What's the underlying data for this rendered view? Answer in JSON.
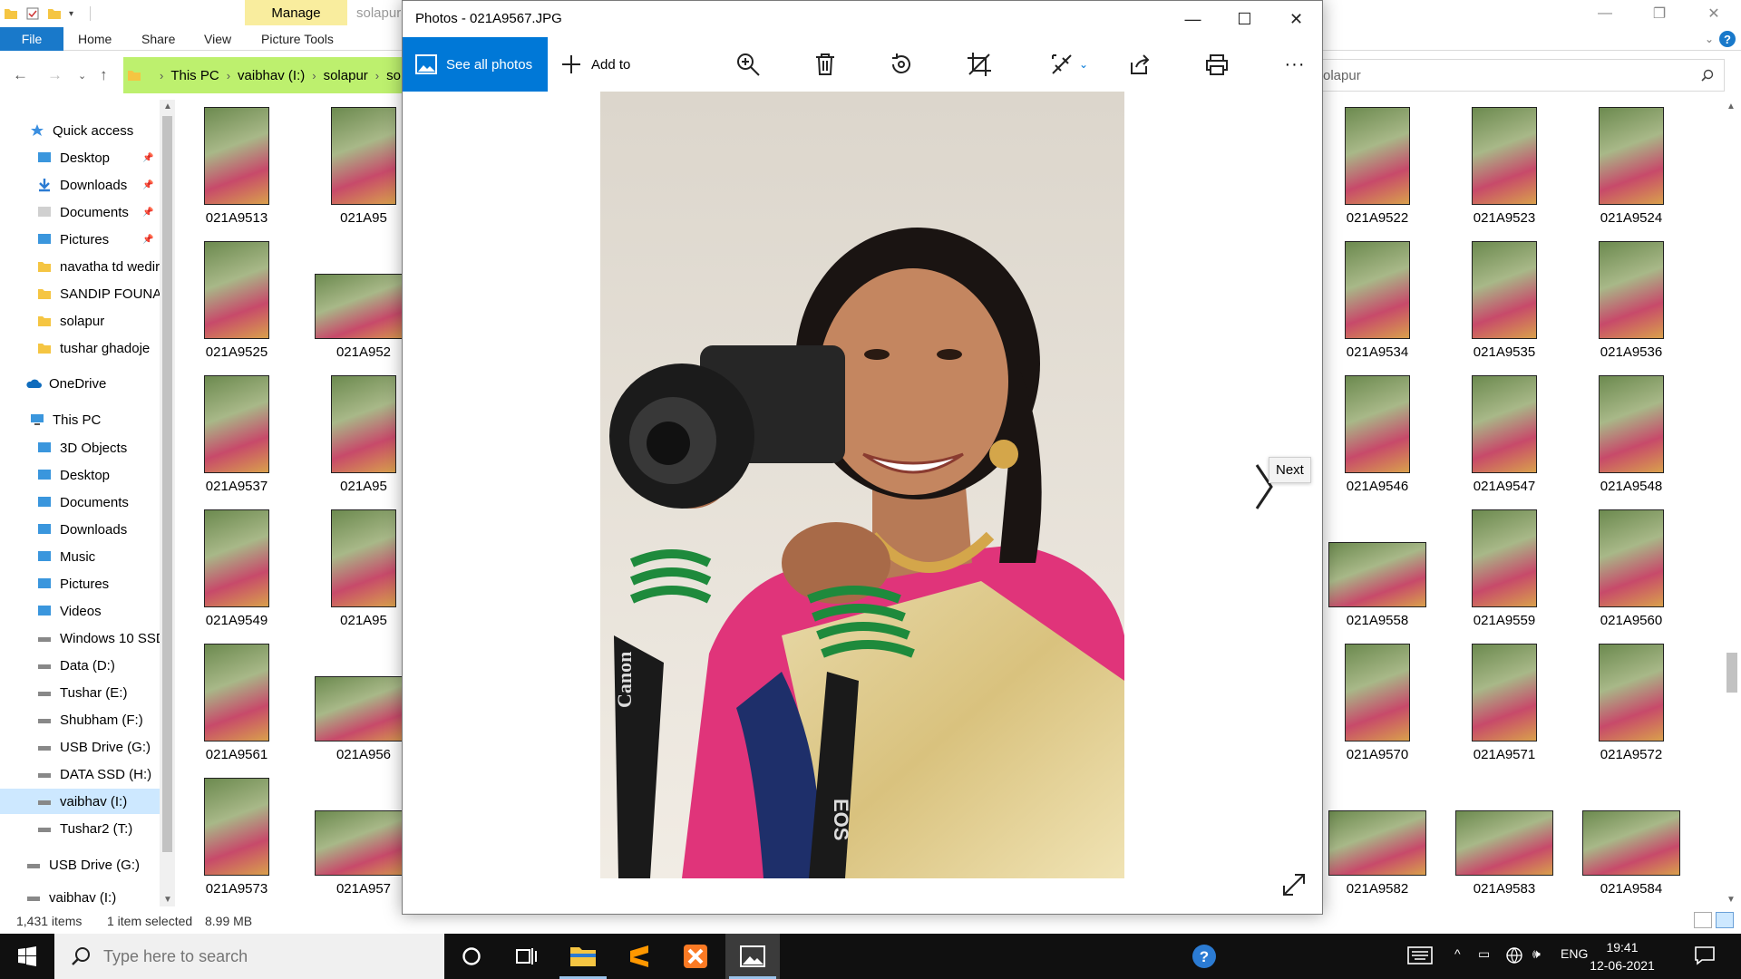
{
  "explorer": {
    "ribbon": {
      "manage_tab": "Manage",
      "title_fragment": "solapur",
      "file_tab": "File",
      "tabs": [
        "Home",
        "Share",
        "View",
        "Picture Tools"
      ]
    },
    "address": {
      "crumbs": [
        "This PC",
        "vaibhav  (I:)",
        "solapur",
        "so"
      ]
    },
    "search": {
      "value": "olapur"
    },
    "nav": {
      "quick_access": "Quick access",
      "quick_items": [
        "Desktop",
        "Downloads",
        "Documents",
        "Pictures",
        "navatha td wedir",
        "SANDIP FOUNAI",
        "solapur",
        "tushar ghadoje"
      ],
      "onedrive": "OneDrive",
      "this_pc": "This PC",
      "pc_items": [
        "3D Objects",
        "Desktop",
        "Documents",
        "Downloads",
        "Music",
        "Pictures",
        "Videos",
        "Windows 10 SSD",
        "Data (D:)",
        "Tushar (E:)",
        "Shubham (F:)",
        "USB Drive (G:)",
        "DATA SSD (H:)",
        "vaibhav  (I:)",
        "Tushar2 (T:)"
      ],
      "usb": "USB Drive (G:)",
      "vaibhav2": "vaibhav  (I:)"
    },
    "files_left": [
      [
        "021A9513",
        "021A95"
      ],
      [
        "021A9525",
        "021A952"
      ],
      [
        "021A9537",
        "021A95"
      ],
      [
        "021A9549",
        "021A95"
      ],
      [
        "021A9561",
        "021A956"
      ],
      [
        "021A9573",
        "021A957"
      ]
    ],
    "files_right": [
      [
        "021A9522",
        "021A9523",
        "021A9524"
      ],
      [
        "021A9534",
        "021A9535",
        "021A9536"
      ],
      [
        "021A9546",
        "021A9547",
        "021A9548"
      ],
      [
        "021A9558",
        "021A9559",
        "021A9560"
      ],
      [
        "021A9570",
        "021A9571",
        "021A9572"
      ],
      [
        "021A9582",
        "021A9583",
        "021A9584"
      ]
    ],
    "status": {
      "items": "1,431 items",
      "selected": "1 item selected",
      "size": "8.99 MB"
    }
  },
  "photos": {
    "title": "Photos - 021A9567.JPG",
    "see_all": "See all photos",
    "add_to": "Add to",
    "next_tooltip": "Next",
    "photo_text": "Canon",
    "photo_text2": "EOS"
  },
  "taskbar": {
    "search_placeholder": "Type here to search",
    "lang": "ENG",
    "time": "19:41",
    "date": "12-06-2021"
  },
  "colors": {
    "accent": "#0078d7",
    "address_bar": "#bdf06e",
    "manage_tab": "#f9ed9e",
    "taskbar": "#101010"
  }
}
